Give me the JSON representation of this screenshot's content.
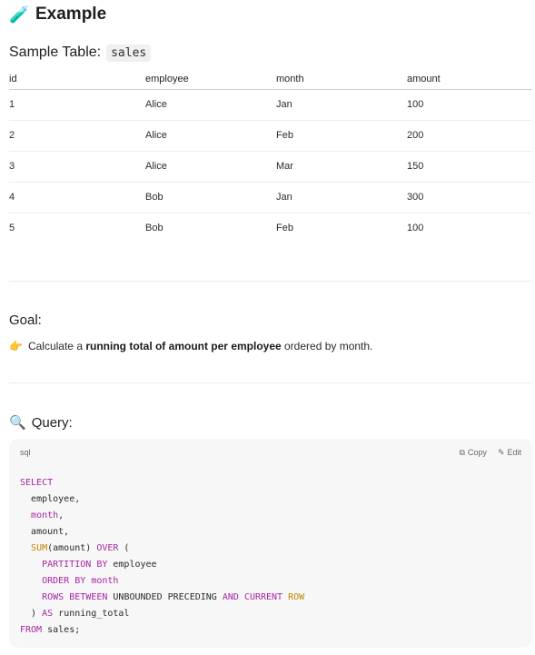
{
  "header": {
    "icon": "test-tube-icon",
    "title": "Example"
  },
  "sample": {
    "label": "Sample Table:",
    "table_name": "sales"
  },
  "table": {
    "columns": [
      "id",
      "employee",
      "month",
      "amount"
    ],
    "rows": [
      [
        "1",
        "Alice",
        "Jan",
        "100"
      ],
      [
        "2",
        "Alice",
        "Feb",
        "200"
      ],
      [
        "3",
        "Alice",
        "Mar",
        "150"
      ],
      [
        "4",
        "Bob",
        "Jan",
        "300"
      ],
      [
        "5",
        "Bob",
        "Feb",
        "100"
      ]
    ]
  },
  "goal": {
    "title": "Goal:",
    "icon": "pointing-hand-icon",
    "prefix": "Calculate a ",
    "bold": "running total of amount per employee",
    "suffix": " ordered by month."
  },
  "query": {
    "icon": "magnifier-icon",
    "title": "Query:",
    "language": "sql",
    "copy_label": "Copy",
    "edit_label": "Edit",
    "code_lines": [
      "SELECT",
      "  employee,",
      "  month,",
      "  amount,",
      "  SUM(amount) OVER (",
      "    PARTITION BY employee",
      "    ORDER BY month",
      "    ROWS BETWEEN UNBOUNDED PRECEDING AND CURRENT ROW",
      "  ) AS running_total",
      "FROM sales;"
    ]
  }
}
